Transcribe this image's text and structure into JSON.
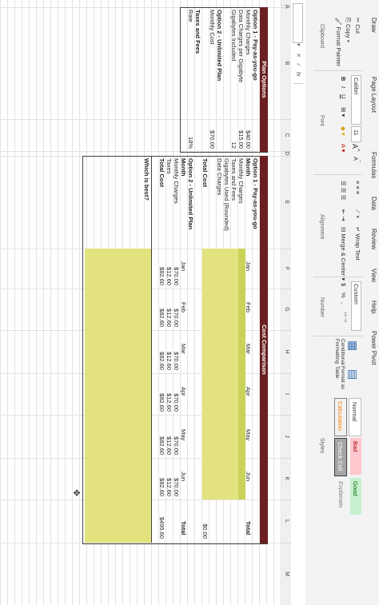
{
  "ribbon": {
    "tabs": [
      "Draw",
      "Page Layout",
      "Formulas",
      "Data",
      "Review",
      "View",
      "Help",
      "Power Pivot"
    ],
    "clipboard": {
      "cut": "Cut",
      "copy": "Copy",
      "format_painter": "Format Painter",
      "group": "Clipboard"
    },
    "font": {
      "name": "Calibri",
      "size": "11",
      "bold": "B",
      "italic": "I",
      "underline": "U",
      "grow": "A",
      "shrink": "A",
      "group": "Font"
    },
    "alignment": {
      "wrap": "Wrap Text",
      "merge": "Merge & Center",
      "group": "Alignment"
    },
    "number": {
      "format": "Custom",
      "currency": "$",
      "percent": "%",
      "comma": ",",
      "group": "Number"
    },
    "styles_btns": {
      "conditional": "Conditional Formatting",
      "format_table": "Format as Table",
      "group": "Styles"
    },
    "styles": {
      "normal": "Normal",
      "bad": "Bad",
      "good": "Good",
      "calculation": "Calculation",
      "check_cell": "Check Cell",
      "explanatory": "Explanato"
    }
  },
  "formula_bar": {
    "fx": "fx"
  },
  "columns": [
    "A",
    "B",
    "C",
    "D",
    "E",
    "F",
    "G",
    "H",
    "I",
    "J",
    "K",
    "L",
    "M"
  ],
  "plan_options": {
    "header": "Plan Options",
    "opt1_title": "Option 1 - Pay-as-you-go",
    "opt1_rows": [
      [
        "Monthly Charges",
        "$40.00"
      ],
      [
        "Data Charges per Gigabyte",
        "$15.00"
      ],
      [
        "Gigabytes Included",
        "12"
      ]
    ],
    "opt2_title": "Option 2 - Unlimited Plan",
    "opt2_rows": [
      [
        "Monthly Cost",
        "$70.00"
      ]
    ],
    "taxes_title": "Taxes and Fees",
    "taxes_rows": [
      [
        "Rate",
        "18%"
      ]
    ]
  },
  "cost_comparison": {
    "header": "Cost Comparison",
    "opt1_title": "Option 1 - Pay-as-you-go",
    "months": [
      "Jan",
      "Feb",
      "Mar",
      "Apr",
      "May",
      "Jun"
    ],
    "total_label": "Total",
    "month_label": "Month",
    "opt1_rows": [
      "Monthly Charges",
      "Taxes and Fees",
      "Gigabytes Used (Rounded)",
      "Data Charges"
    ],
    "opt1_total": "Total Cost",
    "opt1_total_value": "$0.00",
    "opt2_title": "Option 2 - Unlimited Plan",
    "opt2_rows": [
      {
        "label": "Monthly Charges",
        "values": [
          "$70.00",
          "$70.00",
          "$70.00",
          "$70.00",
          "$70.00",
          "$70.00"
        ]
      },
      {
        "label": "Taxes",
        "values": [
          "$12.60",
          "$12.60",
          "$12.60",
          "$12.60",
          "$12.60",
          "$12.60"
        ]
      },
      {
        "label": "Total Cost",
        "values": [
          "$82.60",
          "$82.60",
          "$82.60",
          "$82.60",
          "$82.60",
          "$82.60"
        ],
        "total": "$495.60"
      }
    ],
    "which_best": "Which is best?"
  }
}
